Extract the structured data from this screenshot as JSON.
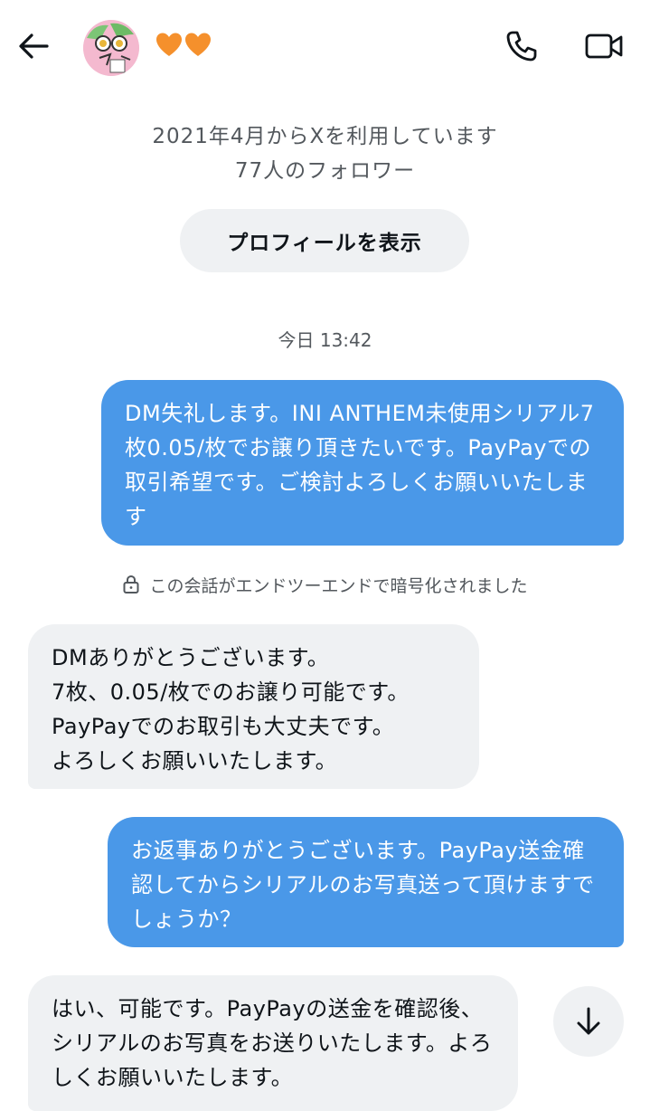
{
  "header": {
    "back_icon": "arrow-left-icon",
    "avatar_icon": "profile-avatar",
    "hearts": "🧡🧡",
    "call_icon": "phone-icon",
    "video_icon": "video-camera-icon"
  },
  "profile": {
    "joined": "2021年4月からXを利用しています",
    "followers": "77人のフォロワー",
    "view_profile_label": "プロフィールを表示"
  },
  "conversation": {
    "timestamp": "今日 13:42",
    "encryption_notice": "この会話がエンドツーエンドで暗号化されました",
    "messages": [
      {
        "direction": "sent",
        "text": "DM失礼します。INI ANTHEM未使用シリアル7枚0.05/枚でお譲り頂きたいです。PayPayでの取引希望です。ご検討よろしくお願いいたします"
      },
      {
        "direction": "received",
        "text": "DMありがとうございます。\n7枚、0.05/枚でのお譲り可能です。\nPayPayでのお取引も大丈夫です。\nよろしくお願いいたします。"
      },
      {
        "direction": "sent",
        "text": "お返事ありがとうございます。PayPay送金確認してからシリアルのお写真送って頂けますでしょうか？"
      },
      {
        "direction": "received",
        "text": "はい、可能です。PayPayの送金を確認後、シリアルのお写真をお送りいたします。よろしくお願いいたします。"
      }
    ]
  },
  "colors": {
    "sent_bubble": "#4a98e8",
    "received_bubble": "#eff1f3",
    "secondary_text": "#53585d"
  },
  "scroll_icon": "arrow-down-icon"
}
